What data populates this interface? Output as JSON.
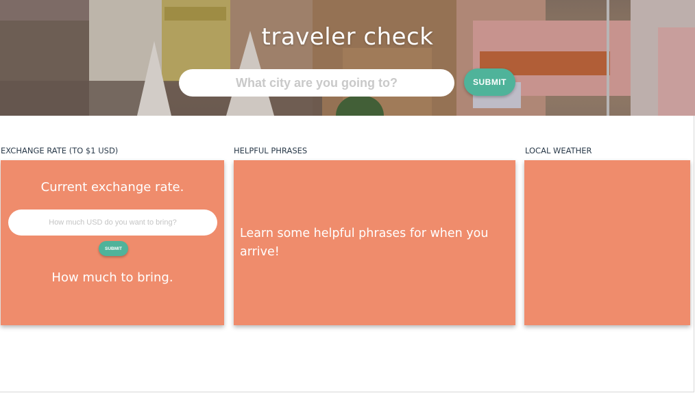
{
  "hero": {
    "title": "traveler check",
    "search_placeholder": "What city are you going to?",
    "submit_label": "SUBMIT"
  },
  "exchange": {
    "label": "EXCHANGE RATE (TO $1 USD)",
    "title": "Current exchange rate.",
    "amount_placeholder": "How much USD do you want to bring?",
    "submit_label": "SUBMIT",
    "result": "How much to bring."
  },
  "phrases": {
    "label": "HELPFUL PHRASES",
    "text": "Learn some helpful phrases for when you arrive!"
  },
  "weather": {
    "label": "LOCAL WEATHER"
  },
  "colors": {
    "card": "#ef8c6c",
    "button": "#4fb39a",
    "label_text": "#2a3a4a"
  }
}
